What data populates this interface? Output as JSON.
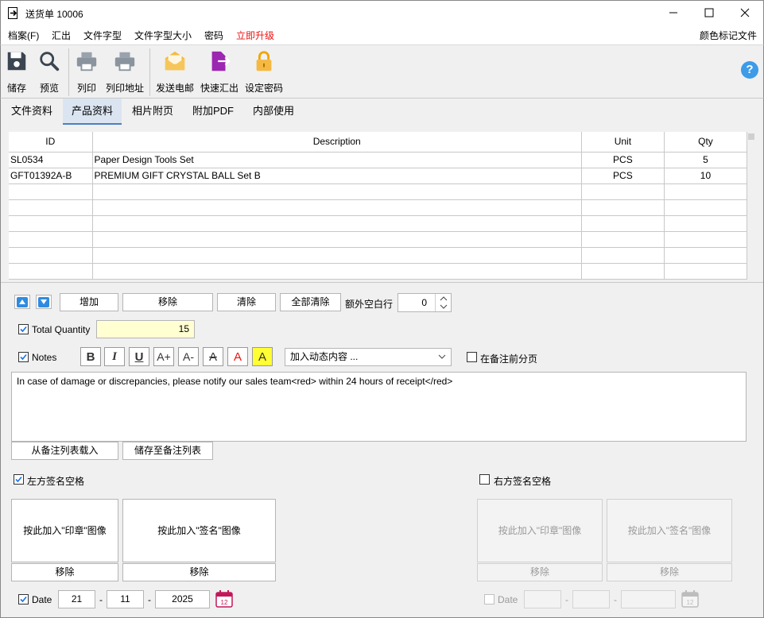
{
  "window": {
    "title": "送货单 10006",
    "controls": {
      "minimize": "minimize",
      "maximize": "maximize",
      "close": "close"
    }
  },
  "menu": {
    "items": [
      "档案(F)",
      "汇出",
      "文件字型",
      "文件字型大小",
      "密码",
      "立即升级"
    ],
    "right_item": "颜色标记文件"
  },
  "toolbar": {
    "save": "储存",
    "preview": "预览",
    "print": "列印",
    "print_address": "列印地址",
    "send_email": "发送电邮",
    "quick_export": "快速汇出",
    "set_password": "设定密码",
    "help": "?"
  },
  "tabs": [
    "文件资料",
    "产品资料",
    "相片附页",
    "附加PDF",
    "内部使用"
  ],
  "table": {
    "headers": [
      "ID",
      "Description",
      "Unit",
      "Qty"
    ],
    "rows": [
      [
        "SL0534",
        "Paper Design Tools Set",
        "PCS",
        "5"
      ],
      [
        "GFT01392A-B",
        "PREMIUM GIFT CRYSTAL BALL Set B",
        "PCS",
        "10"
      ]
    ]
  },
  "row_actions": {
    "add": "增加",
    "remove": "移除",
    "clear": "清除",
    "clear_all": "全部清除",
    "extra_blank_rows_label": "额外空白行",
    "extra_blank_rows_value": "0"
  },
  "total_quantity": {
    "label": "Total Quantity",
    "checked": true,
    "value": "15"
  },
  "notes": {
    "label": "Notes",
    "checked": true,
    "dynamic_content_placeholder": "加入动态内容 ...",
    "page_break_label": "在备注前分页",
    "page_break_checked": false,
    "text": "In case of damage or discrepancies, please notify our sales team<red> within 24 hours of receipt</red>",
    "load_button": "从备注列表载入",
    "save_button": "储存至备注列表"
  },
  "format_buttons": [
    "B",
    "I",
    "U",
    "A+",
    "A-",
    "A",
    "A",
    "A"
  ],
  "signature_left": {
    "label": "左方签名空格",
    "checked": true,
    "stamp_button": "按此加入\"印章\"图像",
    "sign_button": "按此加入\"签名\"图像",
    "remove": "移除",
    "date_label": "Date",
    "date_checked": true,
    "day": "21",
    "month": "11",
    "year": "2025",
    "separator": "-",
    "cal_day": "12"
  },
  "signature_right": {
    "label": "右方签名空格",
    "checked": false,
    "stamp_button": "按此加入\"印章\"图像",
    "sign_button": "按此加入\"签名\"图像",
    "remove": "移除",
    "date_label": "Date",
    "date_checked": false,
    "separator": "-",
    "cal_day": "12"
  }
}
